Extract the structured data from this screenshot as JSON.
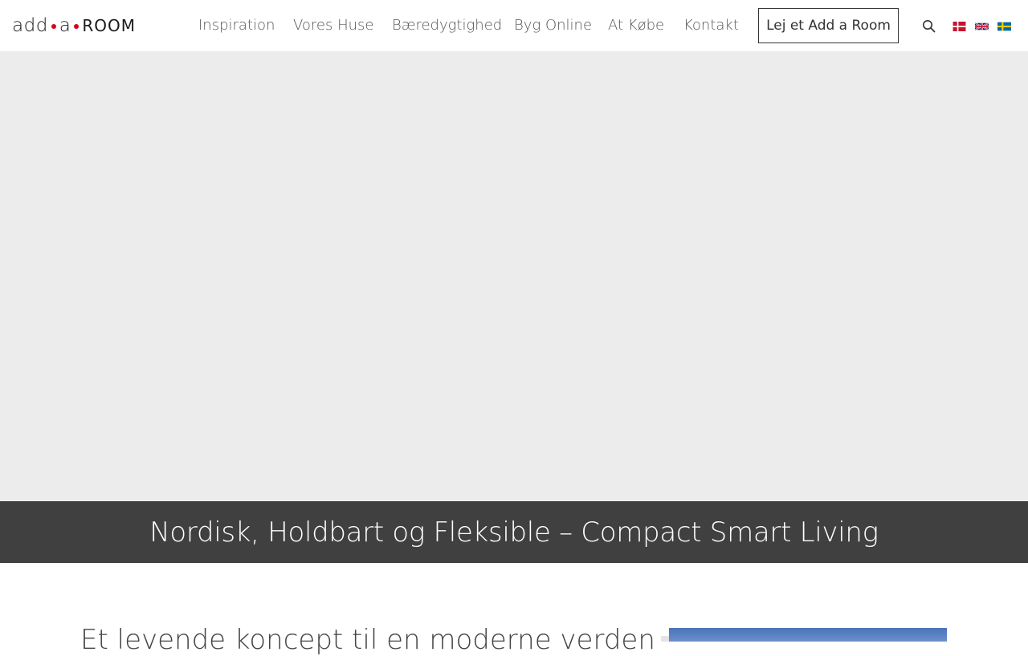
{
  "header": {
    "logo": {
      "part1": "add",
      "part2": "a",
      "part3": "ROOM",
      "accent_color": "#d6001c"
    },
    "nav": {
      "items": [
        {
          "label": "Inspiration"
        },
        {
          "label": "Vores Huse"
        },
        {
          "label": "Bæredygtighed"
        },
        {
          "label": "Byg Online"
        },
        {
          "label": "At Købe"
        },
        {
          "label": "Kontakt"
        }
      ],
      "cta_label": "Lej et Add a Room"
    },
    "icons": {
      "search": "search-icon"
    },
    "languages": [
      {
        "code": "da",
        "icon": "flag-denmark-icon"
      },
      {
        "code": "en",
        "icon": "flag-uk-icon"
      },
      {
        "code": "sv",
        "icon": "flag-sweden-icon"
      }
    ]
  },
  "hero": {
    "title": "Nordisk, Holdbart og Fleksible – Compact Smart Living",
    "band_color": "#404040",
    "media_color": "#ececec"
  },
  "content": {
    "heading": "Et levende koncept til en moderne verden"
  }
}
